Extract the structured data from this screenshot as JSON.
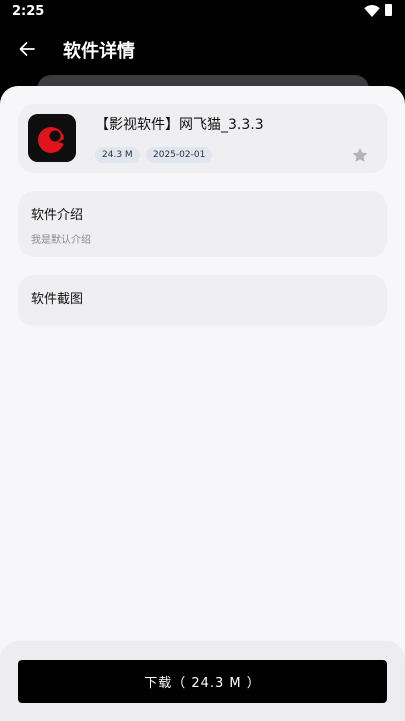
{
  "status_bar": {
    "time": "2:25"
  },
  "header": {
    "title": "软件详情"
  },
  "app": {
    "name": "【影视软件】网飞猫_3.3.3",
    "size": "24.3 M",
    "date": "2025-02-01"
  },
  "intro": {
    "title": "软件介绍",
    "description": "我是默认介绍"
  },
  "screenshots": {
    "title": "软件截图"
  },
  "download": {
    "label": "下载（ 24.3 M ）"
  },
  "colors": {
    "accent": "#000000",
    "logo_red": "#e3131b",
    "sheet": "#f7f7f9",
    "card": "#efeff1",
    "chip": "#dfe6ef"
  },
  "icons": [
    "back-arrow-icon",
    "wifi-icon",
    "battery-icon",
    "app-logo-icon",
    "star-icon"
  ]
}
